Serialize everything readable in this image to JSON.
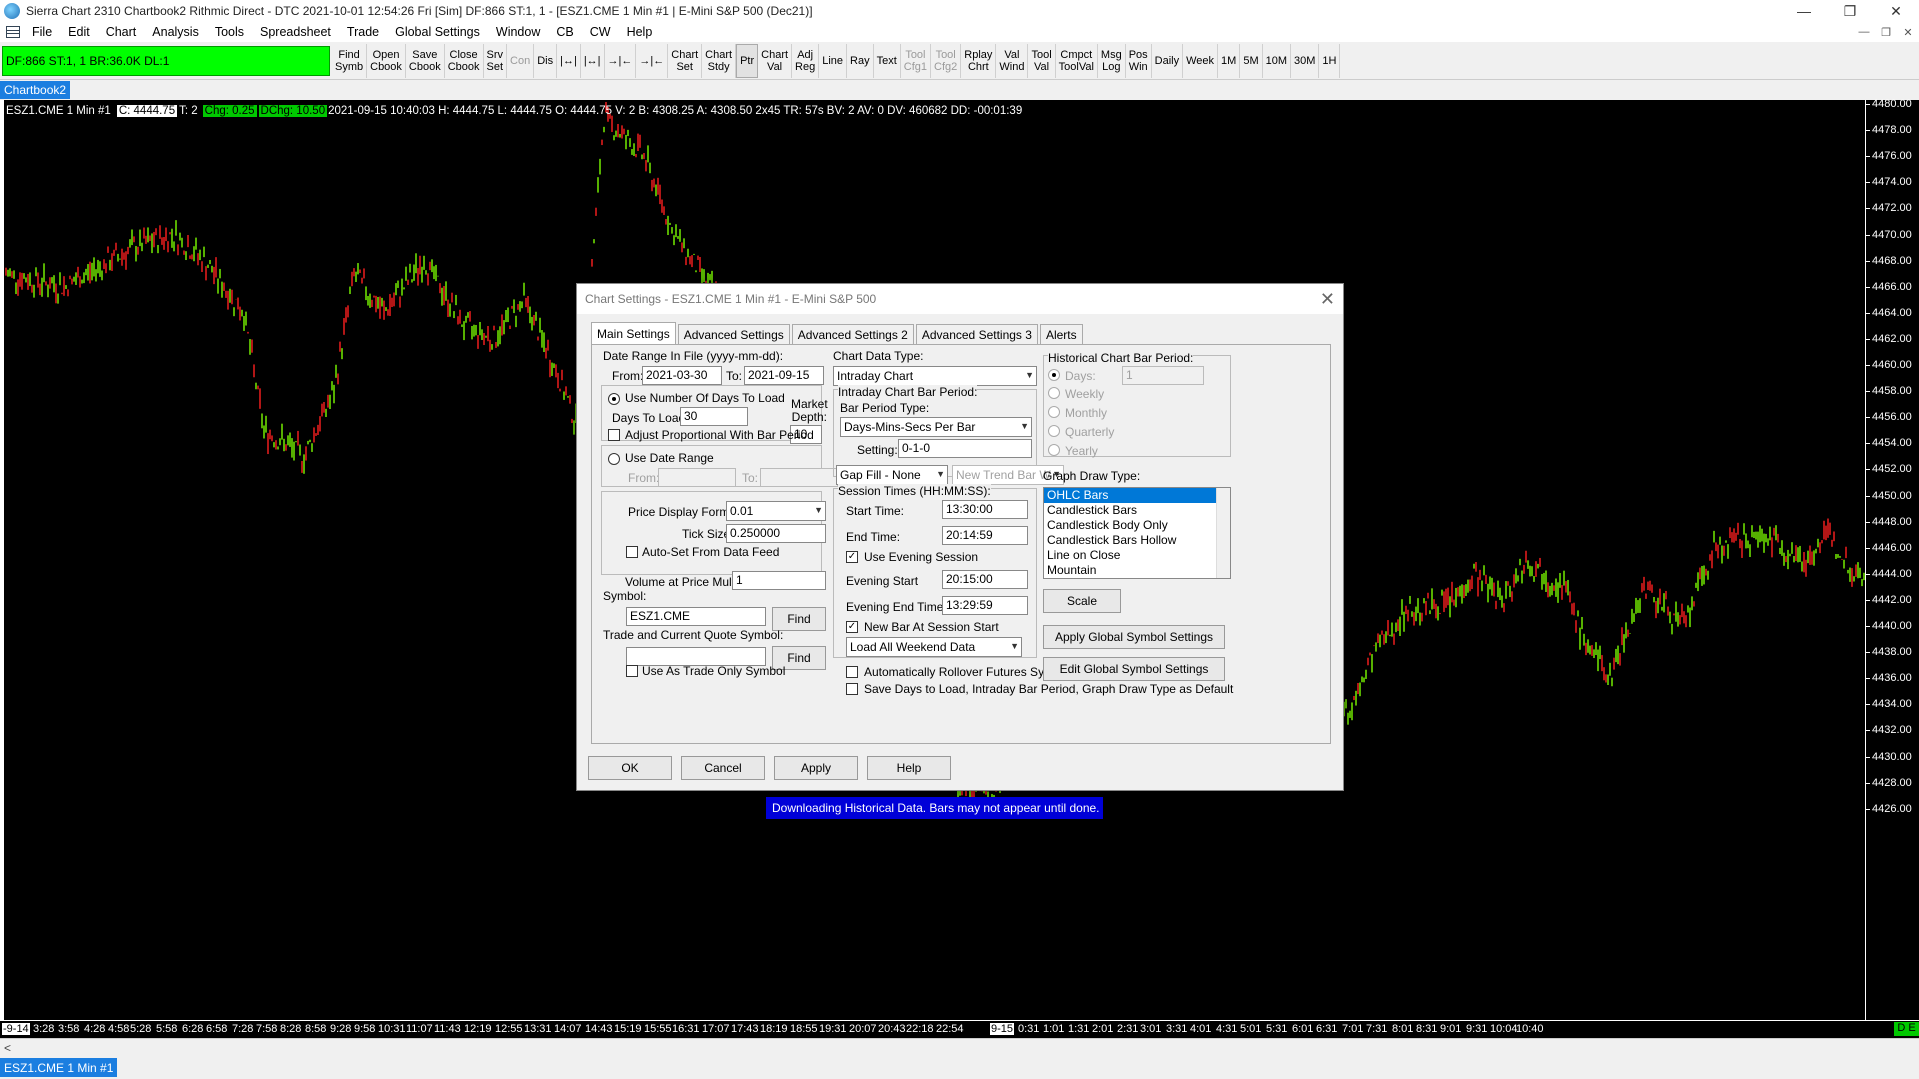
{
  "window": {
    "title": "Sierra Chart 2310 Chartbook2  Rithmic Direct - DTC 2021-10-01  12:54:26 Fri [Sim]  DF:866  ST:1, 1 - [ESZ1.CME  1 Min  #1 | E-Mini S&P 500 (Dec21)]",
    "minimize": "—",
    "restore": "❐",
    "close": "✕"
  },
  "menu": {
    "items": [
      "File",
      "Edit",
      "Chart",
      "Analysis",
      "Tools",
      "Spreadsheet",
      "Trade",
      "Global Settings",
      "Window",
      "CB",
      "CW",
      "Help"
    ],
    "right_controls": [
      "—",
      "❐",
      "✕"
    ]
  },
  "toolbar": {
    "status": "DF:866  ST:1, 1   BR:36.0K  DL:1",
    "buttons": [
      {
        "label": "Find\nSymb",
        "dim": false
      },
      {
        "label": "Open\nCbook",
        "dim": false
      },
      {
        "label": "Save\nCbook",
        "dim": false
      },
      {
        "label": "Close\nCbook",
        "dim": false
      },
      {
        "label": "Srv\nSet",
        "dim": false
      },
      {
        "label": "Con",
        "dim": true
      },
      {
        "label": "Dis",
        "dim": false
      },
      {
        "label": "|↔|",
        "dim": false
      },
      {
        "label": "|↔|",
        "dim": false
      },
      {
        "label": "→|←",
        "dim": false
      },
      {
        "label": "→|←",
        "dim": false
      },
      {
        "label": "Chart\nSet",
        "dim": false
      },
      {
        "label": "Chart\nStdy",
        "dim": false
      },
      {
        "label": "Ptr",
        "dim": false,
        "pressed": true
      },
      {
        "label": "Chart\nVal",
        "dim": false
      },
      {
        "label": "Adj\nReg",
        "dim": false
      },
      {
        "label": "Line",
        "dim": false
      },
      {
        "label": "Ray",
        "dim": false
      },
      {
        "label": "Text",
        "dim": false
      },
      {
        "label": "Tool\nCfg1",
        "dim": true
      },
      {
        "label": "Tool\nCfg2",
        "dim": true
      },
      {
        "label": "Rplay\nChrt",
        "dim": false
      },
      {
        "label": "Val\nWind",
        "dim": false
      },
      {
        "label": "Tool\nVal",
        "dim": false
      },
      {
        "label": "Cmpct\nToolVal",
        "dim": false
      },
      {
        "label": "Msg\nLog",
        "dim": false
      },
      {
        "label": "Pos\nWin",
        "dim": false
      },
      {
        "label": "Daily",
        "dim": false
      },
      {
        "label": "Week",
        "dim": false
      },
      {
        "label": "1M",
        "dim": false
      },
      {
        "label": "5M",
        "dim": false
      },
      {
        "label": "10M",
        "dim": false
      },
      {
        "label": "30M",
        "dim": false
      },
      {
        "label": "1H",
        "dim": false
      }
    ]
  },
  "chartbook_tab": "Chartbook2",
  "chart_info": {
    "symbol": "ESZ1.CME  1 Min   #1",
    "close": "C: 4444.75",
    "ticks": "T: 2",
    "chg": "Chg: 0.25",
    "dchg": "DChg: 10.50",
    "rest": "2021-09-15 10:40:03  H: 4444.75  L: 4444.75  O: 4444.75  V: 2  B: 4308.25  A: 4308.50  2x45  TR: 57s  BV: 2  AV: 0  DV: 460682  DD: -00:01:39"
  },
  "y_axis": [
    "4480.00",
    "4478.00",
    "4476.00",
    "4474.00",
    "4472.00",
    "4470.00",
    "4468.00",
    "4466.00",
    "4464.00",
    "4462.00",
    "4460.00",
    "4458.00",
    "4456.00",
    "4454.00",
    "4452.00",
    "4450.00",
    "4448.00",
    "4446.00",
    "4444.00",
    "4442.00",
    "4440.00",
    "4438.00",
    "4436.00",
    "4434.00",
    "4432.00",
    "4430.00",
    "4428.00",
    "4426.00"
  ],
  "x_axis": [
    "-9-14",
    "3:28",
    "3:58",
    "4:28",
    "4:58",
    "5:28",
    "5:58",
    "6:28",
    "6:58",
    "7:28",
    "7:58",
    "8:28",
    "8:58",
    "9:28",
    "9:58",
    "10:31",
    "11:07",
    "11:43",
    "12:19",
    "12:55",
    "13:31",
    "14:07",
    "14:43",
    "15:19",
    "15:55",
    "16:31",
    "17:07",
    "17:43",
    "18:19",
    "18:55",
    "19:31",
    "20:07",
    "20:43",
    "22:18",
    "22:54",
    "9-15",
    "0:31",
    "1:01",
    "1:31",
    "2:01",
    "2:31",
    "3:01",
    "3:31",
    "4:01",
    "4:31",
    "5:01",
    "5:31",
    "6:01",
    "6:31",
    "7:01",
    "7:31",
    "8:01",
    "8:31",
    "9:01",
    "9:31",
    "10:04",
    "10:40"
  ],
  "badge_de": "D E",
  "bottom_tab": "ESZ1.CME  1 Min   #1",
  "download_message": "Downloading Historical Data. Bars may not appear until done.",
  "dialog": {
    "title": "Chart Settings - ESZ1.CME  1 Min   #1 - E-Mini S&P 500",
    "close": "✕",
    "tabs": [
      "Main Settings",
      "Advanced Settings",
      "Advanced Settings 2",
      "Advanced Settings 3",
      "Alerts"
    ],
    "date_range_label": "Date Range In File (yyyy-mm-dd):",
    "from_label": "From:",
    "from_value": "2021-03-30",
    "to_label": "To:",
    "to_value": "2021-09-15",
    "use_days_label": "Use Number Of Days To Load",
    "days_to_load_label": "Days To Load:",
    "days_to_load_value": "30",
    "market_depth_label": "Market\nDepth:",
    "market_depth_value": "10",
    "adjust_label": "Adjust Proportional With Bar Period",
    "use_date_range_label": "Use Date Range",
    "dr_from_label": "From:",
    "dr_to_label": "To:",
    "price_format_label": "Price Display Format:",
    "price_format_value": "0.01",
    "tick_size_label": "Tick Size:",
    "tick_size_value": "0.250000",
    "auto_set_label": "Auto-Set From Data Feed",
    "vol_mult_label": "Volume at Price Mult.:",
    "vol_mult_value": "1",
    "symbol_label": "Symbol:",
    "symbol_value": "ESZ1.CME",
    "find_label": "Find",
    "trade_quote_label": "Trade and Current Quote Symbol:",
    "trade_quote_value": "",
    "find2_label": "Find",
    "trade_only_label": "Use As Trade Only Symbol",
    "chart_data_type_label": "Chart Data Type:",
    "chart_data_type_value": "Intraday Chart",
    "intraday_period_label": "Intraday Chart Bar Period:",
    "bar_period_type_label": "Bar Period Type:",
    "bar_period_type_value": "Days-Mins-Secs Per Bar",
    "setting_label": "Setting:",
    "setting_value": "0-1-0",
    "gap_fill_value": "Gap Fill - None",
    "new_trend_value": "New Trend Bar W",
    "session_label": "Session Times (HH:MM:SS):",
    "start_time_label": "Start Time:",
    "start_time_value": "13:30:00",
    "end_time_label": "End Time:",
    "end_time_value": "20:14:59",
    "use_evening_label": "Use Evening Session",
    "evening_start_label": "Evening Start",
    "evening_start_value": "20:15:00",
    "evening_end_label": "Evening End Time:",
    "evening_end_value": "13:29:59",
    "new_bar_label": "New Bar At Session Start",
    "weekend_value": "Load All Weekend Data",
    "rollover_label": "Automatically Rollover Futures Symbol",
    "save_days_label": "Save Days to Load, Intraday Bar Period, Graph Draw Type as Default",
    "hist_period_label": "Historical Chart Bar Period:",
    "hist_days_label": "Days:",
    "hist_days_value": "1",
    "hist_weekly": "Weekly",
    "hist_monthly": "Monthly",
    "hist_quarterly": "Quarterly",
    "hist_yearly": "Yearly",
    "graph_draw_label": "Graph Draw Type:",
    "graph_draw_items": [
      "OHLC Bars",
      "Candlestick Bars",
      "Candlestick Body Only",
      "Candlestick Bars Hollow",
      "Line on Close",
      "Mountain"
    ],
    "scale_label": "Scale",
    "apply_global_label": "Apply Global Symbol Settings",
    "edit_global_label": "Edit Global Symbol Settings",
    "ok_label": "OK",
    "cancel_label": "Cancel",
    "apply_label": "Apply",
    "help_label": "Help"
  },
  "colors": {
    "up_bar": "#7cfc00",
    "down_bar": "#ff2020",
    "accent": "#1b7ee0",
    "status_green": "#00ff00"
  }
}
